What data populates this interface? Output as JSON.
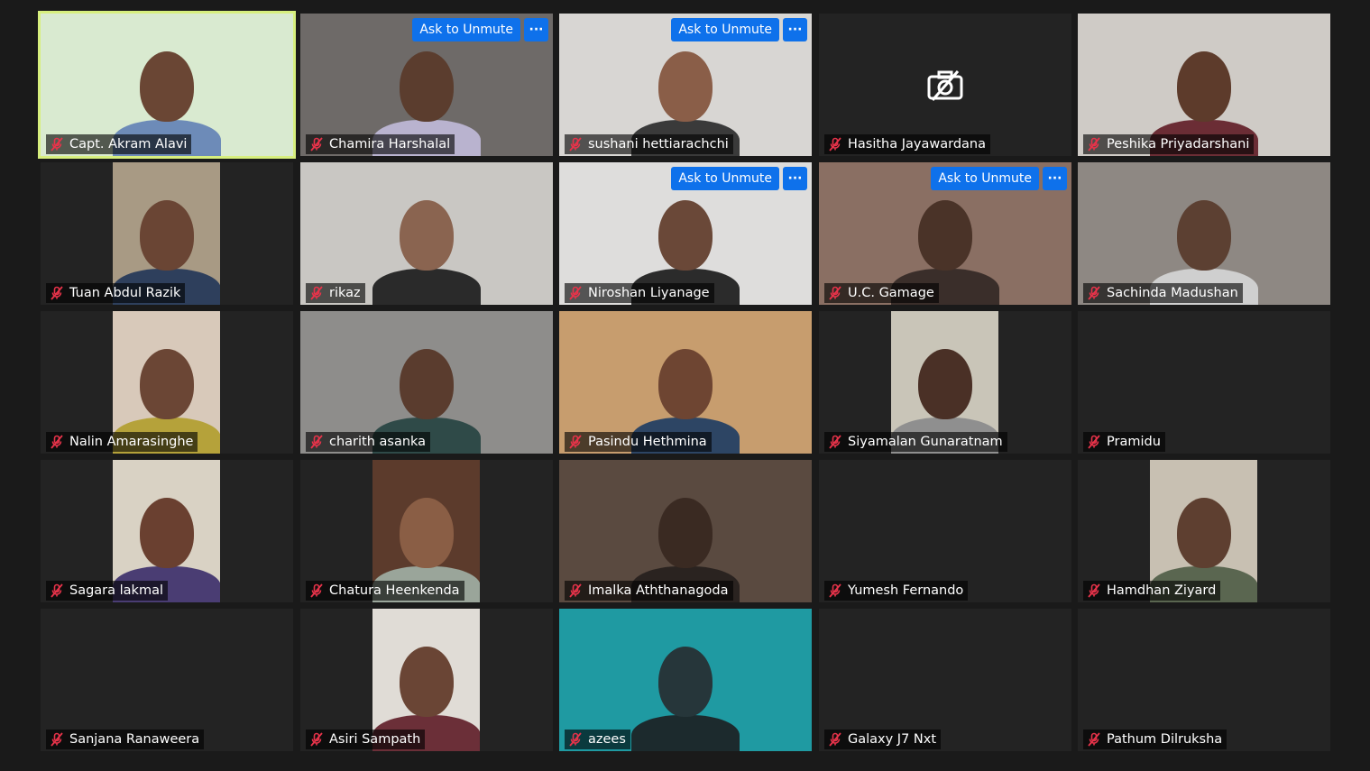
{
  "meeting": {
    "labels": {
      "ask_to_unmute": "Ask to Unmute",
      "more": "···"
    },
    "colors": {
      "active_speaker_border": "#d7ef7e",
      "accent": "#0e71eb",
      "muted": "#e8334a"
    },
    "participants": [
      {
        "name": "Capt. Akram Alavi",
        "active_speaker": true,
        "video": "full",
        "bg": "#d9ead0",
        "skin": "#6a4634",
        "shirt": "#6d8bb8",
        "ask_unmute": false
      },
      {
        "name": "Chamira Harshalal",
        "video": "full",
        "bg": "#6e6a68",
        "skin": "#5b3d2e",
        "shirt": "#b9b3cf",
        "ask_unmute": true
      },
      {
        "name": "sushani hettiarachchi",
        "video": "full",
        "bg": "#d8d6d3",
        "skin": "#8a5e48",
        "shirt": "#3a3a3a",
        "ask_unmute": true
      },
      {
        "name": "Hasitha Jayawardana",
        "video": "off",
        "ask_unmute": false
      },
      {
        "name": "Peshika Priyadarshani",
        "video": "full",
        "bg": "#cfcbc6",
        "skin": "#5d3b2b",
        "shirt": "#6b2d35",
        "ask_unmute": false
      },
      {
        "name": "Tuan Abdul Razik",
        "video": "narrow",
        "bg": "#a89a84",
        "skin": "#6a4534",
        "shirt": "#2e3f5c",
        "ask_unmute": false
      },
      {
        "name": "rikaz",
        "video": "full",
        "bg": "#c9c7c3",
        "skin": "#8a6450",
        "shirt": "#2a2a2a",
        "ask_unmute": false
      },
      {
        "name": "Niroshan Liyanage",
        "video": "full",
        "bg": "#dedddc",
        "skin": "#6a4838",
        "shirt": "#2b2b2b",
        "ask_unmute": true
      },
      {
        "name": "U.C. Gamage",
        "video": "full",
        "bg": "#8a6f63",
        "skin": "#4a3328",
        "shirt": "#3a2e2a",
        "ask_unmute": true
      },
      {
        "name": "Sachinda Madushan",
        "video": "full",
        "bg": "#8e8883",
        "skin": "#5c4032",
        "shirt": "#cfcfcf",
        "ask_unmute": false
      },
      {
        "name": "Nalin Amarasinghe",
        "video": "narrow",
        "bg": "#d8c9ba",
        "skin": "#6b4635",
        "shirt": "#b5a23a",
        "ask_unmute": false
      },
      {
        "name": "charith asanka",
        "video": "full",
        "bg": "#8e8d8b",
        "skin": "#5a3c2e",
        "shirt": "#2f4a48",
        "ask_unmute": false
      },
      {
        "name": "Pasindu Hethmina",
        "video": "full",
        "bg": "#c79d6e",
        "skin": "#6e4532",
        "shirt": "#2d4564",
        "ask_unmute": false
      },
      {
        "name": "Siyamalan Gunaratnam",
        "video": "narrow",
        "bg": "#c9c5b8",
        "skin": "#4a3026",
        "shirt": "#8f8f8f",
        "ask_unmute": false
      },
      {
        "name": "Pramidu",
        "video": "none",
        "ask_unmute": false
      },
      {
        "name": "Sagara lakmal",
        "video": "narrow",
        "bg": "#d9d2c4",
        "skin": "#6a4030",
        "shirt": "#4a3d73",
        "ask_unmute": false
      },
      {
        "name": "Chatura Heenkenda",
        "video": "narrow",
        "bg": "#5c3b2c",
        "skin": "#8a5e45",
        "shirt": "#9aa59a",
        "ask_unmute": false
      },
      {
        "name": "Imalka Aththanagoda",
        "video": "full",
        "bg": "#5a4a40",
        "skin": "#3a2a22",
        "shirt": "#2a2320",
        "ask_unmute": false
      },
      {
        "name": "Yumesh Fernando",
        "video": "none",
        "ask_unmute": false
      },
      {
        "name": "Hamdhan Ziyard",
        "video": "narrow",
        "bg": "#c8c0b2",
        "skin": "#5e3f30",
        "shirt": "#5a6650",
        "ask_unmute": false
      },
      {
        "name": "Sanjana Ranaweera",
        "video": "none",
        "ask_unmute": false
      },
      {
        "name": "Asiri Sampath",
        "video": "narrow",
        "bg": "#e0dcd6",
        "skin": "#6a4535",
        "shirt": "#6b2f38",
        "ask_unmute": false
      },
      {
        "name": "azees",
        "video": "full",
        "bg": "#1f9aa2",
        "skin": "#26363a",
        "shirt": "#1c2a2d",
        "ask_unmute": false
      },
      {
        "name": "Galaxy J7 Nxt",
        "video": "none",
        "ask_unmute": false
      },
      {
        "name": "Pathum Dilruksha",
        "video": "none",
        "ask_unmute": false
      }
    ]
  }
}
